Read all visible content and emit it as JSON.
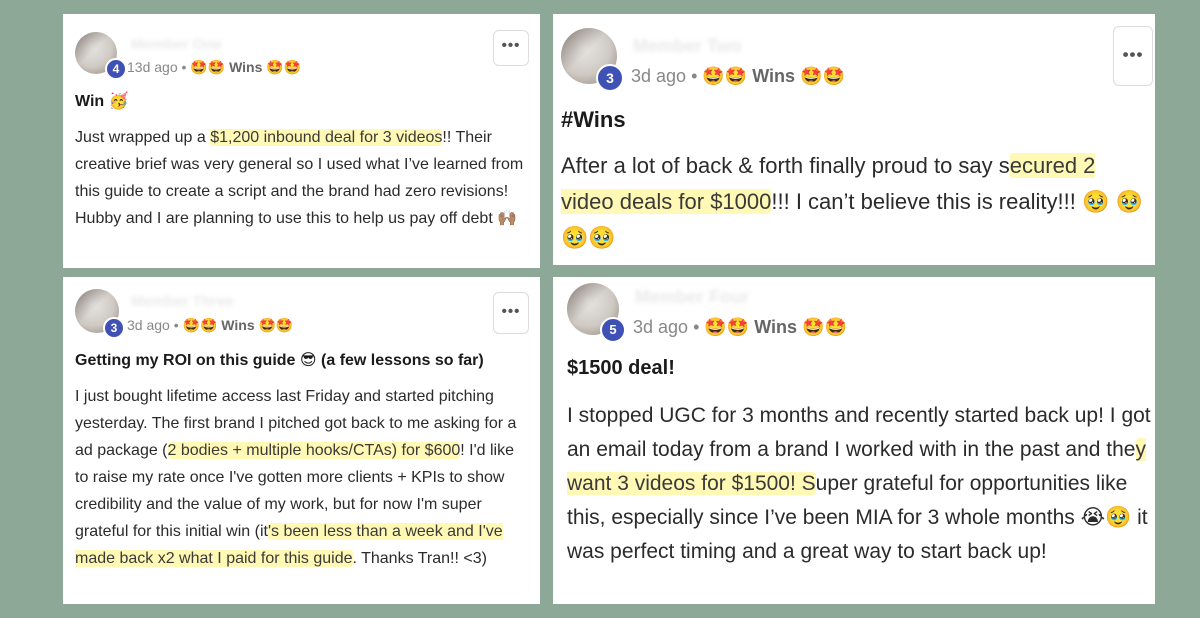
{
  "posts": [
    {
      "level": "4",
      "username": "Member One",
      "time": "13d ago",
      "category_prefix": "🤩🤩",
      "category": "Wins",
      "category_suffix": "🤩🤩",
      "title": "Win 🥳",
      "body": [
        {
          "text": "Just wrapped up a "
        },
        {
          "text": "$1,200 inbound deal for 3 videos",
          "hl": true
        },
        {
          "text": "!! Their creative brief was very general so I used what I’ve learned from this guide to create a script and the brand had zero revisions! Hubby and I are planning to use this to help us pay off debt 🙌🏽"
        }
      ],
      "more_label": "•••"
    },
    {
      "level": "3",
      "username": "Member Two",
      "time": "3d ago",
      "category_prefix": "🤩🤩",
      "category": "Wins",
      "category_suffix": "🤩🤩",
      "title": "#Wins",
      "body": [
        {
          "text": "After a lot of back & forth finally proud to say s"
        },
        {
          "text": "ecured 2 video deals for $1000",
          "hl": true
        },
        {
          "text": "!!! I can’t believe this is reality!!! 🥹 🥹🥹🥹"
        }
      ],
      "more_label": "•••"
    },
    {
      "level": "3",
      "username": "Member Three",
      "time": "3d ago",
      "category_prefix": "🤩🤩",
      "category": "Wins",
      "category_suffix": "🤩🤩",
      "title": "Getting my ROI on this guide 😎 (a few lessons so far)",
      "body": [
        {
          "text": "I just bought lifetime access last Friday and started pitching yesterday. The first brand I pitched got back to me asking for a ad package ("
        },
        {
          "text": "2 bodies + multiple hooks/CTAs) for $600",
          "hl": true
        },
        {
          "text": "! I'd like to raise my rate once I've gotten more clients + KPIs to show credibility and the value of my work, but for now I'm super grateful for this initial win (it"
        },
        {
          "text": "'s been less than a week and I've made back x2 what I paid for this guide",
          "hl": true
        },
        {
          "text": ". Thanks Tran!! <3)"
        }
      ],
      "more_label": "•••"
    },
    {
      "level": "5",
      "username": "Member Four",
      "time": "3d ago",
      "category_prefix": "🤩🤩",
      "category": "Wins",
      "category_suffix": "🤩🤩",
      "title": "$1500 deal!",
      "body": [
        {
          "text": "I stopped UGC for 3 months and recently started back up! I got an email today from a brand I worked with in the past and the"
        },
        {
          "text": "y want 3 videos for $1500! S",
          "hl": true
        },
        {
          "text": "uper grateful for opportunities like this, especially since I’ve been MIA for 3 whole months 😭🥹 it was perfect timing and a great way to start back up!"
        }
      ]
    }
  ]
}
